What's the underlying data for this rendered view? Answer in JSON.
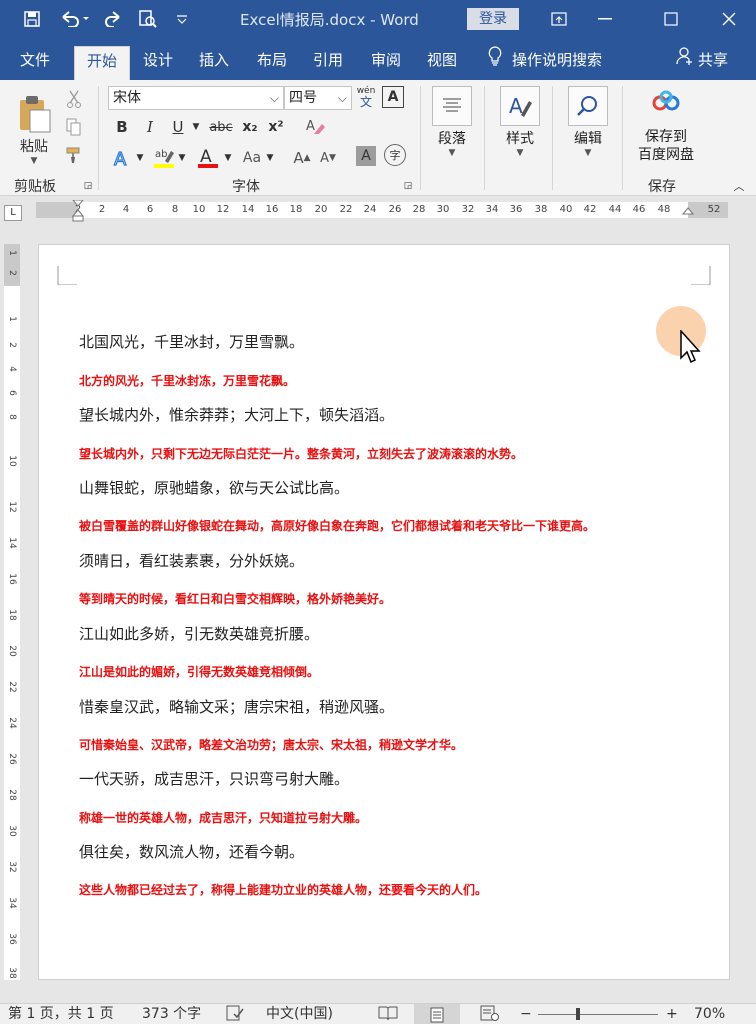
{
  "window": {
    "title": "Excel情报局.docx  -  Word",
    "login_label": "登录"
  },
  "menu": {
    "tabs": [
      "文件",
      "开始",
      "设计",
      "插入",
      "布局",
      "引用",
      "审阅",
      "视图"
    ],
    "tell_me": "操作说明搜索",
    "share": "共享"
  },
  "ribbon": {
    "clipboard": {
      "paste_label": "粘贴",
      "group_label": "剪贴板"
    },
    "font": {
      "font_name": "宋体",
      "font_size": "四号",
      "bold": "B",
      "italic": "I",
      "underline": "U",
      "strike": "abc",
      "subscript": "x₂",
      "superscript": "x²",
      "phonetic": "wén",
      "phonetic_sub": "文",
      "border_char": "A",
      "change_case": "Aa",
      "grow": "A",
      "shrink": "A",
      "shade_char": "A",
      "enclose_char": "字",
      "group_label": "字体"
    },
    "paragraph": {
      "label": "段落"
    },
    "styles": {
      "label": "样式"
    },
    "editing": {
      "label": "编辑"
    },
    "save": {
      "line1": "保存到",
      "line2": "百度网盘",
      "group_label": "保存"
    }
  },
  "ruler": {
    "tab_selector": "L",
    "numbers": [
      "2",
      "2",
      "4",
      "6",
      "8",
      "10",
      "12",
      "14",
      "16",
      "18",
      "20",
      "22",
      "24",
      "26",
      "28",
      "30",
      "32",
      "34",
      "36",
      "38",
      "40",
      "42",
      "44",
      "46",
      "48",
      "52"
    ],
    "vertical_numbers": [
      "1",
      "2",
      "1",
      "2",
      "4",
      "6",
      "8",
      "10",
      "12",
      "14",
      "16",
      "18",
      "20",
      "22",
      "24",
      "26",
      "28",
      "30",
      "32",
      "34",
      "36",
      "38"
    ]
  },
  "document": {
    "lines": [
      {
        "poem": "北国风光，千里冰封，万里雪飘。",
        "translation": "北方的风光，千里冰封冻，万里雪花飘。"
      },
      {
        "poem": "望长城内外，惟余莽莽；大河上下，顿失滔滔。",
        "translation": "望长城内外，只剩下无边无际白茫茫一片。整条黄河，立刻失去了波涛滚滚的水势。"
      },
      {
        "poem": "山舞银蛇，原驰蜡象，欲与天公试比高。",
        "translation": "被白雪覆盖的群山好像银蛇在舞动，高原好像白象在奔跑，它们都想试着和老天爷比一下谁更高。"
      },
      {
        "poem": "须晴日，看红装素裹，分外妖娆。",
        "translation": "等到晴天的时候，看红日和白雪交相辉映，格外娇艳美好。"
      },
      {
        "poem": "江山如此多娇，引无数英雄竞折腰。",
        "translation": "江山是如此的媚娇，引得无数英雄竞相倾倒。"
      },
      {
        "poem": "惜秦皇汉武，略输文采；唐宗宋祖，稍逊风骚。",
        "translation": "可惜秦始皇、汉武帝，略差文治功劳；唐太宗、宋太祖，稍逊文学才华。"
      },
      {
        "poem": "一代天骄，成吉思汗，只识弯弓射大雕。",
        "translation": "称雄一世的英雄人物，成吉思汗，只知道拉弓射大雕。"
      },
      {
        "poem": "俱往矣，数风流人物，还看今朝。",
        "translation": "这些人物都已经过去了，称得上能建功立业的英雄人物，还要看今天的人们。"
      }
    ],
    "translation_color": "#e81010"
  },
  "status": {
    "page": "第 1 页，共 1 页",
    "words": "373 个字",
    "language": "中文(中国)",
    "zoom": "70%",
    "zoom_minus": "−",
    "zoom_plus": "+"
  },
  "colors": {
    "word_blue": "#2b579a",
    "highlight_yellow": "#ffff00",
    "font_red": "#e81010"
  }
}
